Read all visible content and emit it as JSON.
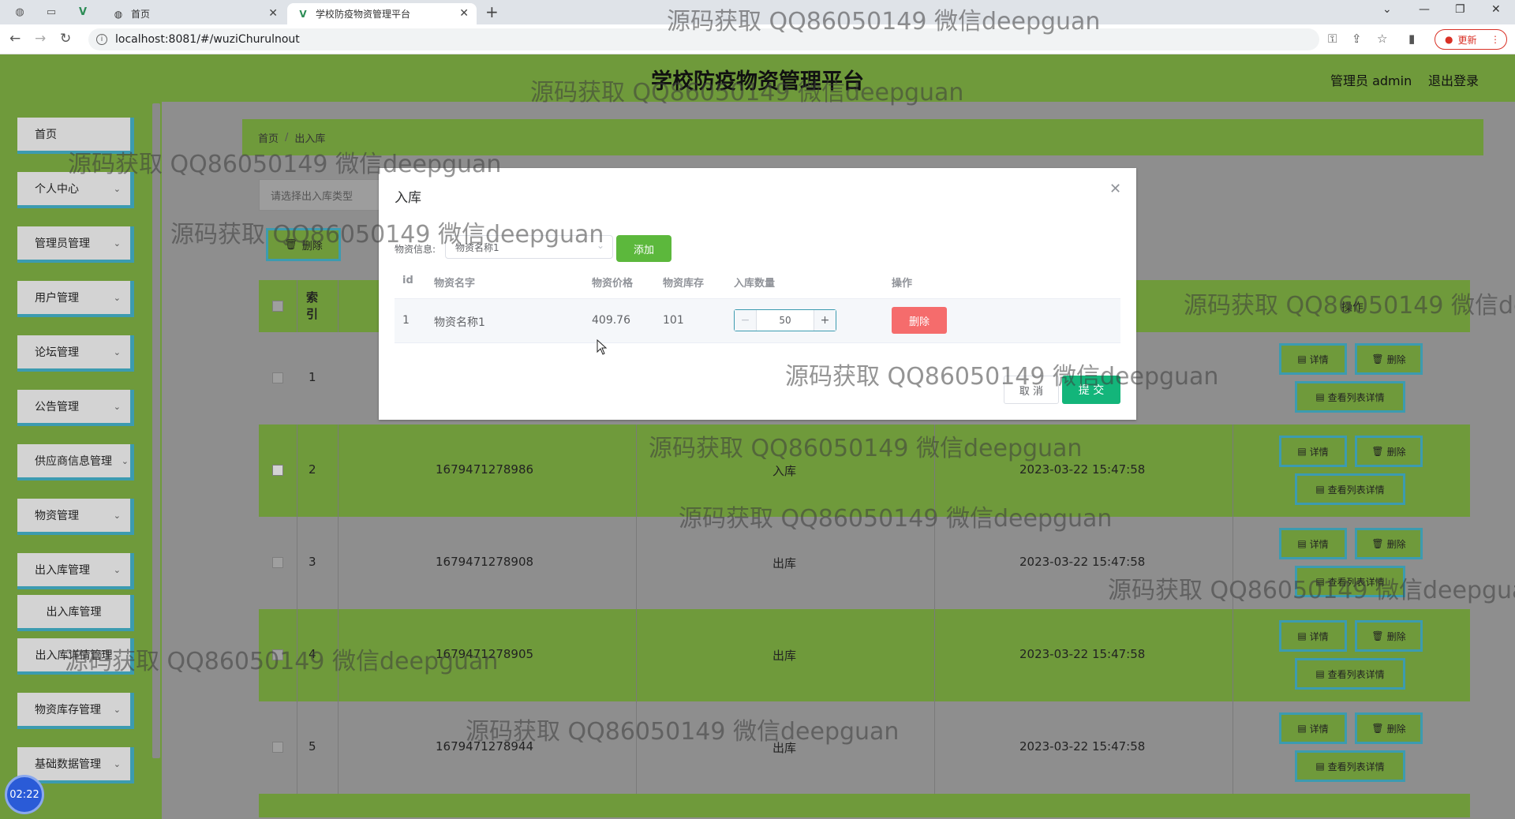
{
  "browser": {
    "tabs": [
      {
        "title": "首页",
        "active": false
      },
      {
        "title": "学校防疫物资管理平台",
        "active": true
      }
    ],
    "new_tab_glyph": "+",
    "url": "localhost:8081/#/wuziChurulnout",
    "update_label": "更新"
  },
  "app": {
    "title": "学校防疫物资管理平台",
    "admin_label": "管理员 admin",
    "logout_label": "退出登录"
  },
  "sidebar": {
    "items": [
      {
        "label": "首页",
        "chevron": false
      },
      {
        "label": "个人中心",
        "chevron": true
      },
      {
        "label": "管理员管理",
        "chevron": true
      },
      {
        "label": "用户管理",
        "chevron": true
      },
      {
        "label": "论坛管理",
        "chevron": true
      },
      {
        "label": "公告管理",
        "chevron": true
      },
      {
        "label": "供应商信息管理",
        "chevron": true
      },
      {
        "label": "物资管理",
        "chevron": true
      },
      {
        "label": "出入库管理",
        "chevron": true
      },
      {
        "label": "出入库管理",
        "chevron": false
      },
      {
        "label": "出入库详情管理",
        "chevron": false
      },
      {
        "label": "物资库存管理",
        "chevron": true
      },
      {
        "label": "基础数据管理",
        "chevron": true
      }
    ],
    "timer": "02:22"
  },
  "main": {
    "breadcrumb": [
      "首页",
      "出入库"
    ],
    "filter_placeholder": "请选择出入库类型",
    "delete_label": "删除",
    "table": {
      "index_header": "索引",
      "op_header": "操作",
      "rows": [
        {
          "index": "1",
          "code": "",
          "type": "",
          "time": "",
          "checked": false
        },
        {
          "index": "2",
          "code": "1679471278986",
          "type": "入库",
          "time": "2023-03-22 15:47:58",
          "checked": true
        },
        {
          "index": "3",
          "code": "1679471278908",
          "type": "出库",
          "time": "2023-03-22 15:47:58",
          "checked": false
        },
        {
          "index": "4",
          "code": "1679471278905",
          "type": "出库",
          "time": "2023-03-22 15:47:58",
          "checked": false
        },
        {
          "index": "5",
          "code": "1679471278944",
          "type": "出库",
          "time": "2023-03-22 15:47:58",
          "checked": false
        }
      ],
      "row_actions": {
        "detail": "详情",
        "delete": "删除",
        "list_detail": "查看列表详情"
      }
    }
  },
  "dialog": {
    "title": "入库",
    "goods_label": "物资信息:",
    "goods_selected": "物资名称1",
    "add_label": "添加",
    "columns": [
      "id",
      "物资名字",
      "物资价格",
      "物资库存",
      "入库数量",
      "操作"
    ],
    "rows": [
      {
        "id": "1",
        "name": "物资名称1",
        "price": "409.76",
        "stock": "101",
        "quantity": "50"
      }
    ],
    "row_delete_label": "删除",
    "cancel_label": "取 消",
    "submit_label": "提 交"
  },
  "watermark_text": "源码获取 QQ86050149 微信deepguan",
  "colors": {
    "app_green": "#6f9a3b",
    "button_border": "#3c9bb0",
    "dialog_add": "#5cb83c",
    "dialog_delete": "#f56c6c",
    "dialog_submit": "#13b57a"
  }
}
